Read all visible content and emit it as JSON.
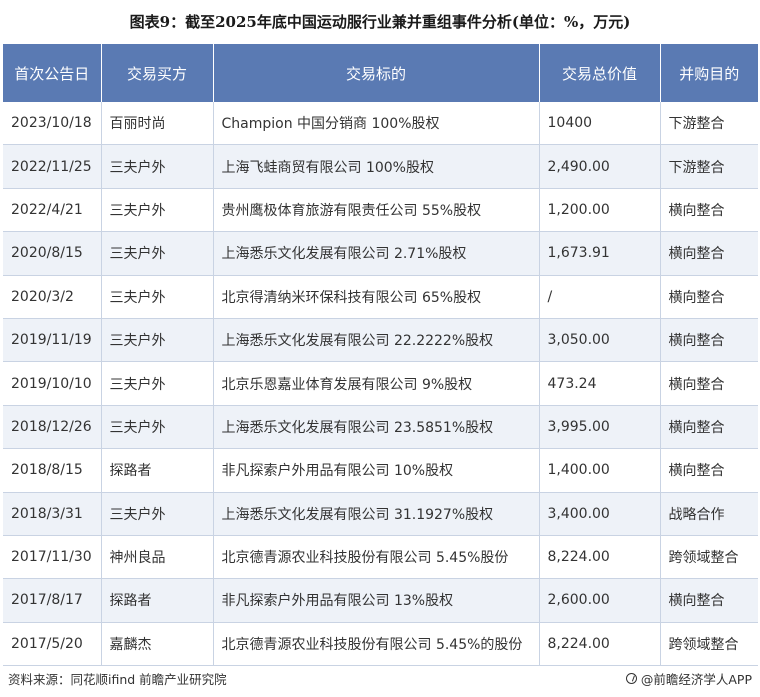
{
  "title": "图表9：截至2025年底中国运动服行业兼并重组事件分析(单位：%，万元)",
  "table": {
    "headers": [
      "首次公告日",
      "交易买方",
      "交易标的",
      "交易总价值",
      "并购目的"
    ],
    "rows": [
      [
        "2023/10/18",
        "百丽时尚",
        "Champion 中国分销商 100%股权",
        "10400",
        "下游整合"
      ],
      [
        "2022/11/25",
        "三夫户外",
        "上海飞蛙商贸有限公司 100%股权",
        "2,490.00",
        "下游整合"
      ],
      [
        "2022/4/21",
        "三夫户外",
        "贵州鹰极体育旅游有限责任公司 55%股权",
        "1,200.00",
        "横向整合"
      ],
      [
        "2020/8/15",
        "三夫户外",
        "上海悉乐文化发展有限公司 2.71%股权",
        "1,673.91",
        "横向整合"
      ],
      [
        "2020/3/2",
        "三夫户外",
        "北京得清纳米环保科技有限公司 65%股权",
        "/",
        "横向整合"
      ],
      [
        "2019/11/19",
        "三夫户外",
        "上海悉乐文化发展有限公司 22.2222%股权",
        "3,050.00",
        "横向整合"
      ],
      [
        "2019/10/10",
        "三夫户外",
        "北京乐恩嘉业体育发展有限公司 9%股权",
        "473.24",
        "横向整合"
      ],
      [
        "2018/12/26",
        "三夫户外",
        "上海悉乐文化发展有限公司 23.5851%股权",
        "3,995.00",
        "横向整合"
      ],
      [
        "2018/8/15",
        "探路者",
        "非凡探索户外用品有限公司 10%股权",
        "1,400.00",
        "横向整合"
      ],
      [
        "2018/3/31",
        "三夫户外",
        "上海悉乐文化发展有限公司 31.1927%股权",
        "3,400.00",
        "战略合作"
      ],
      [
        "2017/11/30",
        "神州良品",
        "北京德青源农业科技股份有限公司 5.45%股份",
        "8,224.00",
        "跨领域整合"
      ],
      [
        "2017/8/17",
        "探路者",
        "非凡探索户外用品有限公司 13%股权",
        "2,600.00",
        "横向整合"
      ],
      [
        "2017/5/20",
        "嘉麟杰",
        "北京德青源农业科技股份有限公司 5.45%的股份",
        "8,224.00",
        "跨领域整合"
      ]
    ]
  },
  "footer": {
    "source": "资料来源：同花顺ifind 前瞻产业研究院",
    "brand": "@前瞻经济学人APP",
    "brand_icon": "qianzhan-logo-icon"
  }
}
